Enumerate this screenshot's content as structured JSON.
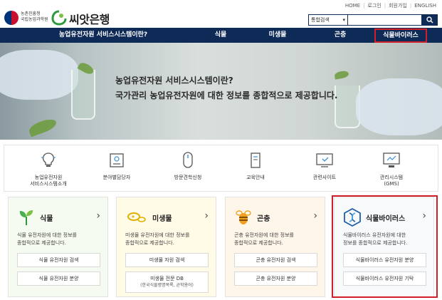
{
  "util_links": [
    "HOME",
    "로그인",
    "회원가입",
    "ENGLISH"
  ],
  "institution": {
    "line1": "농촌진흥청",
    "line2": "국립농업과학원"
  },
  "brand": "씨앗은행",
  "search": {
    "scope": "통합검색",
    "placeholder": ""
  },
  "nav": {
    "intro": "농업유전자원 서비스시스템이란?",
    "plant": "식물",
    "microbe": "미생물",
    "insect": "곤충",
    "biorus": "식물바이러스"
  },
  "hero": {
    "line1": "농업유전자원 서비스시스템이란?",
    "line2": "국가관리 농업유전자원에 대한 정보를 종합적으로 제공합니다."
  },
  "quick_links": [
    {
      "line1": "농업유전자원",
      "line2": "서비스시스템소개",
      "icon": "lightbulb-icon"
    },
    {
      "line1": "분야별담당자",
      "line2": "",
      "icon": "id-card-icon"
    },
    {
      "line1": "방문견학신청",
      "line2": "",
      "icon": "mouse-icon"
    },
    {
      "line1": "교육안내",
      "line2": "",
      "icon": "book-icon"
    },
    {
      "line1": "관련사이트",
      "line2": "",
      "icon": "monitor-icon"
    },
    {
      "line1": "관리시스템",
      "line2": "(GMS)",
      "icon": "computer-icon"
    }
  ],
  "cards": [
    {
      "title": "식물",
      "icon": "sprout-icon",
      "desc1": "식물 유전자원에 대한 정보를",
      "desc2": "종합적으로 제공합니다.",
      "btn1": "식물 유전자원 검색",
      "btn2": "식물 유전자원 분양"
    },
    {
      "title": "미생물",
      "icon": "microbe-icon",
      "desc1": "미생물 유전자원에 대한 정보를",
      "desc2": "종합적으로 제공합니다.",
      "btn1": "미생물 자원 검색",
      "btn2": "미생물 전문 DB",
      "btn2_sub": "(한국식물병명목록, 균학용어)"
    },
    {
      "title": "곤충",
      "icon": "bee-icon",
      "desc1": "곤충 유전자원에 대한 정보를",
      "desc2": "종합적으로 제공합니다.",
      "btn1": "곤충 유전자원 검색",
      "btn2": "곤충 유전자원 분양"
    },
    {
      "title": "식물바이러스",
      "icon": "virus-icon",
      "desc1": "식물바이러스 유전자원에 대한",
      "desc2": "정보를 종합적으로 제공합니다.",
      "btn1": "식물바이러스 유전자원 분양",
      "btn2": "식물바이러스 유전자원 기탁"
    }
  ],
  "colors": {
    "nav_bg": "#0e2a57",
    "highlight": "#d11f2a"
  }
}
